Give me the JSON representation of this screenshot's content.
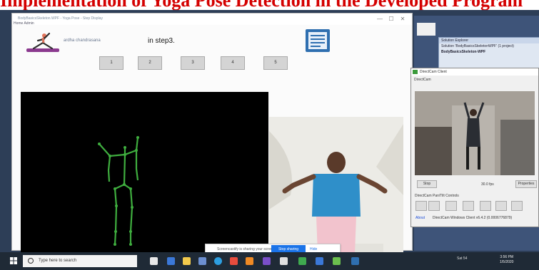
{
  "caption": {
    "text": "Implementation of Yoga Pose Detection in the Developed Program"
  },
  "desktop": {
    "solution_explorer": {
      "title": "Solution Explorer",
      "items": [
        "Solution 'BodyBasicsSkeletonWPF' (1 project)",
        "BodyBasicsSkeleton-WPF"
      ]
    }
  },
  "app": {
    "title": "BodyBasicsSkeleton.WPF - Yoga Pose - Step Display",
    "menu": "Home  Admin",
    "pose_label": "ardha chandrasana",
    "step_text": "in step3.",
    "step_buttons": [
      "1",
      "2",
      "3",
      "4",
      "5"
    ],
    "window_buttons": [
      "—",
      "☐",
      "✕"
    ]
  },
  "popup": {
    "message": "Screencastify is sharing your screen.",
    "button": "Stop sharing",
    "hide": "Hide"
  },
  "cam": {
    "title": "DirectCam Client",
    "device": "DirectCam",
    "stop_label": "Stop",
    "fps": "30.0 fps",
    "settings_label": "Properties",
    "ptz_label": "DirectCam Pan/Tilt Controls",
    "status": "DirectCam Windows Client v6.4.2 (0.0006776879)",
    "link": "About"
  },
  "taskbar": {
    "search_placeholder": "Type here to search",
    "tray": "Sat 54",
    "time": "3:56 PM",
    "date": "1/5/2020"
  },
  "colors": {
    "skeleton": "#3fae3f",
    "accent": "#1a73e8",
    "caption": "#d40000"
  }
}
